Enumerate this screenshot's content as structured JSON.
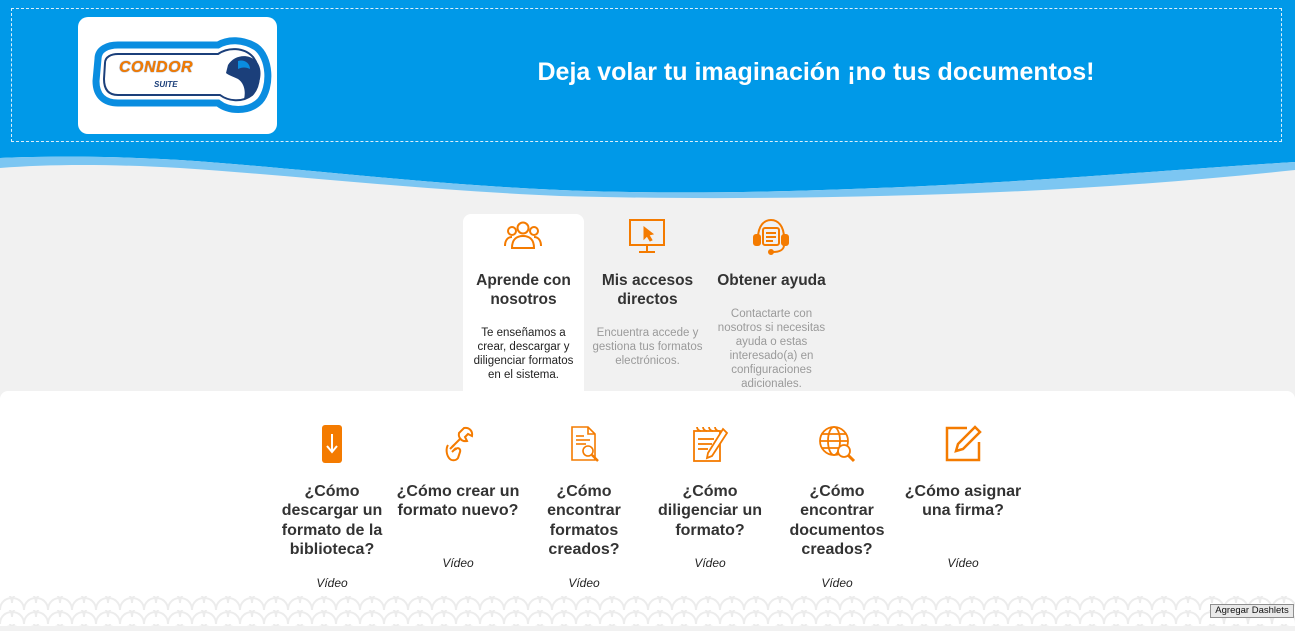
{
  "header": {
    "logo": {
      "word": "CONDOR",
      "sub": "SUITE"
    },
    "tagline": "Deja volar tu imaginación ¡no tus documentos!",
    "brand_color": "#0099e8",
    "accent_color": "#f47b00"
  },
  "top_cards": [
    {
      "icon": "users-icon",
      "title": "Aprende con nosotros",
      "description": "Te enseñamos a crear, descargar y diligenciar formatos en el sistema.",
      "active": true
    },
    {
      "icon": "monitor-cursor-icon",
      "title": "Mis accesos directos",
      "description": "Encuentra accede y gestiona tus formatos electrónicos.",
      "active": false
    },
    {
      "icon": "support-headset-icon",
      "title": "Obtener ayuda",
      "description": "Contactarte con nosotros si necesitas ayuda o estas interesado(a) en configuraciones adicionales.",
      "active": false
    }
  ],
  "videos": [
    {
      "icon": "download-icon",
      "title": "¿Cómo descargar un formato de la biblioteca?",
      "link": "Vídeo"
    },
    {
      "icon": "wrench-hand-icon",
      "title": "¿Cómo crear un formato nuevo?",
      "link": "Vídeo"
    },
    {
      "icon": "document-search-icon",
      "title": "¿Cómo encontrar formatos creados?",
      "link": "Vídeo"
    },
    {
      "icon": "form-pencil-icon",
      "title": "¿Cómo diligenciar un formato?",
      "link": "Vídeo"
    },
    {
      "icon": "globe-search-icon",
      "title": "¿Cómo encontrar documentos creados?",
      "link": "Vídeo"
    },
    {
      "icon": "edit-square-icon",
      "title": "¿Cómo asignar una firma?",
      "link": "Vídeo"
    }
  ],
  "footer": {
    "add_dashlets_label": "Agregar Dashlets"
  }
}
